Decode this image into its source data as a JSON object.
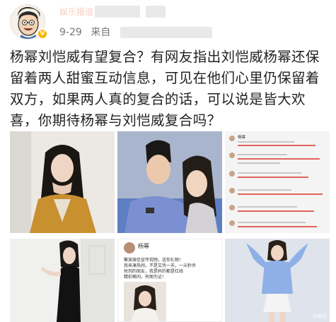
{
  "post": {
    "username": "娱乐报道",
    "date": "9-29",
    "source_prefix": "来自",
    "text": "杨幂刘恺威有望复合？有网友指出刘恺威杨幂还保留着两人甜蜜互动信息，可见在他们心里仍保留着双方，如果两人真的复合的话，可以说是皆大欢喜，你期待杨幂与刘恺威复合吗？"
  },
  "images": {
    "watermark": "@娱乐",
    "screenshot_name": "杨幂",
    "screenshot2_name": "杨幂",
    "screenshot2_lines": [
      "聚美微信宣传视频，送你礼物！",
      "我来凑热闹，不是又凭一天，一元秒杀",
      "抢到的朋友，我是妈的都是红线",
      "精彩瞬间，有图为证！"
    ]
  },
  "colors": {
    "username": "#eb7350",
    "badge": "#f7b500",
    "text": "#222222",
    "meta": "#777777"
  }
}
